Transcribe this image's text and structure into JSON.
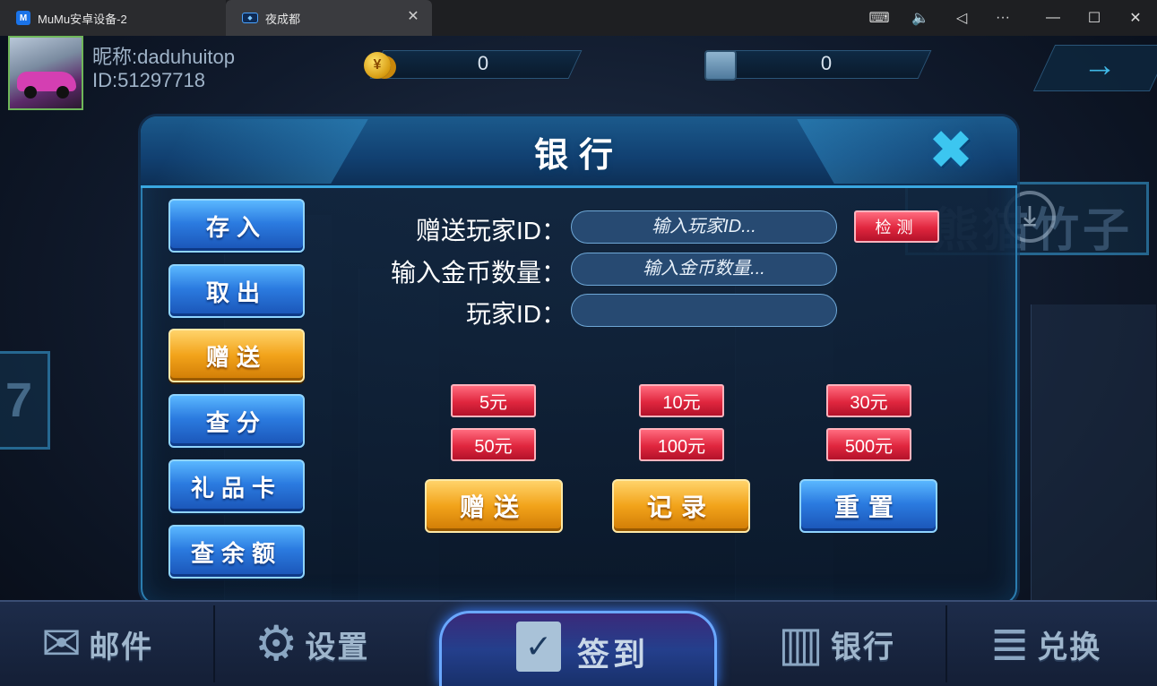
{
  "window": {
    "tabs": [
      {
        "label": "MuMu安卓设备-2",
        "icon": "mumu-app-icon"
      },
      {
        "label": "夜成都",
        "icon": "game-app-icon"
      }
    ],
    "tab_close_glyph": "✕",
    "controls": {
      "keyboard": "⌨",
      "volume": "🔈",
      "back": "◁",
      "more": "···",
      "minimize": "—",
      "maximize": "☐",
      "close": "✕"
    }
  },
  "player": {
    "nickname": "昵称:daduhuitop",
    "id": "ID:51297718",
    "gold": "0",
    "diamonds": "0"
  },
  "background": {
    "left_sign": "7",
    "right_sign": "熊猫竹子"
  },
  "dialog": {
    "title": "银行",
    "close_glyph": "✖",
    "menu": [
      {
        "label": "存入",
        "style": "blue"
      },
      {
        "label": "取出",
        "style": "blue"
      },
      {
        "label": "赠送",
        "style": "orange",
        "selected": true
      },
      {
        "label": "查分",
        "style": "blue"
      },
      {
        "label": "礼品卡",
        "style": "blue"
      },
      {
        "label": "查余额",
        "style": "blue"
      }
    ],
    "form": {
      "player_id_label": "赠送玩家ID：",
      "player_id_placeholder": "输入玩家ID...",
      "check_button": "检测",
      "amount_label": "输入金币数量：",
      "amount_placeholder": "输入金币数量...",
      "nickname_id_label": "玩家ID："
    },
    "amounts": [
      "5元",
      "10元",
      "30元",
      "50元",
      "100元",
      "500元"
    ],
    "actions": {
      "gift": "赠送",
      "records": "记录",
      "reset": "重置"
    }
  },
  "bottom_nav": [
    {
      "label": "邮件",
      "icon": "mail-icon"
    },
    {
      "label": "设置",
      "icon": "gear-icon"
    },
    {
      "label": "签到",
      "icon": "checkin-icon"
    },
    {
      "label": "银行",
      "icon": "bank-building-icon"
    },
    {
      "label": "兑换",
      "icon": "coin-stack-icon"
    }
  ],
  "colors": {
    "accent_blue": "#2b7be0",
    "accent_orange": "#f2a31a",
    "accent_red": "#e0263e",
    "panel": "#122842"
  }
}
